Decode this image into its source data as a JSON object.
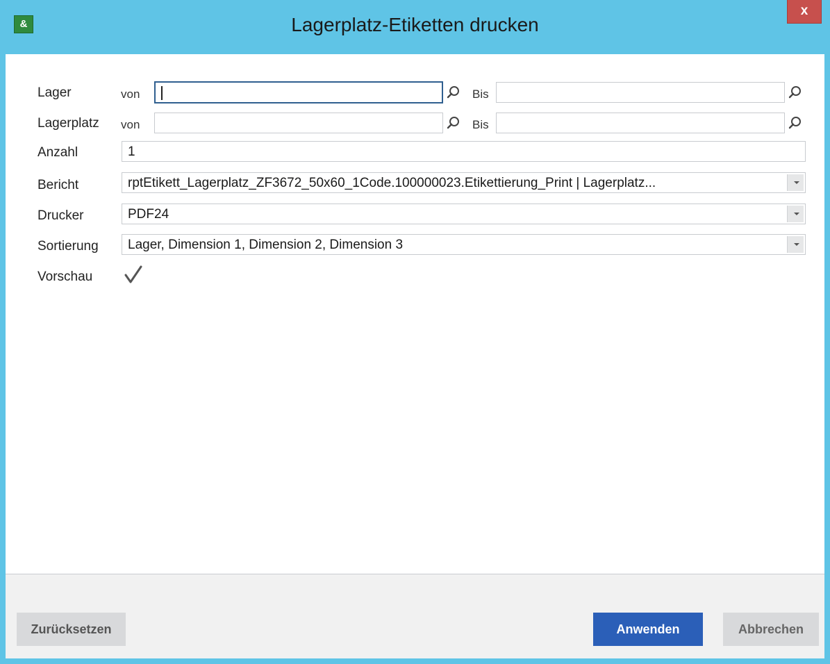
{
  "window": {
    "title": "Lagerplatz-Etiketten drucken",
    "close_label": "x",
    "accent_color": "#5fc4e6"
  },
  "form": {
    "lager": {
      "label": "Lager",
      "from_label": "von",
      "to_label": "Bis",
      "from_value": "",
      "to_value": ""
    },
    "lagerplatz": {
      "label": "Lagerplatz",
      "from_label": "von",
      "to_label": "Bis",
      "from_value": "",
      "to_value": ""
    },
    "anzahl": {
      "label": "Anzahl",
      "value": "1"
    },
    "bericht": {
      "label": "Bericht",
      "value": "rptEtikett_Lagerplatz_ZF3672_50x60_1Code.100000023.Etikettierung_Print | Lagerplatz..."
    },
    "drucker": {
      "label": "Drucker",
      "value": "PDF24"
    },
    "sortierung": {
      "label": "Sortierung",
      "value": "Lager, Dimension 1, Dimension 2, Dimension 3"
    },
    "vorschau": {
      "label": "Vorschau",
      "checked": true
    }
  },
  "footer": {
    "reset_label": "Zurücksetzen",
    "apply_label": "Anwenden",
    "cancel_label": "Abbrechen",
    "apply_color": "#2b5fb8"
  },
  "icons": {
    "search": "search-icon",
    "dropdown": "chevron-down-icon",
    "check": "check-icon",
    "app": "app-icon"
  }
}
